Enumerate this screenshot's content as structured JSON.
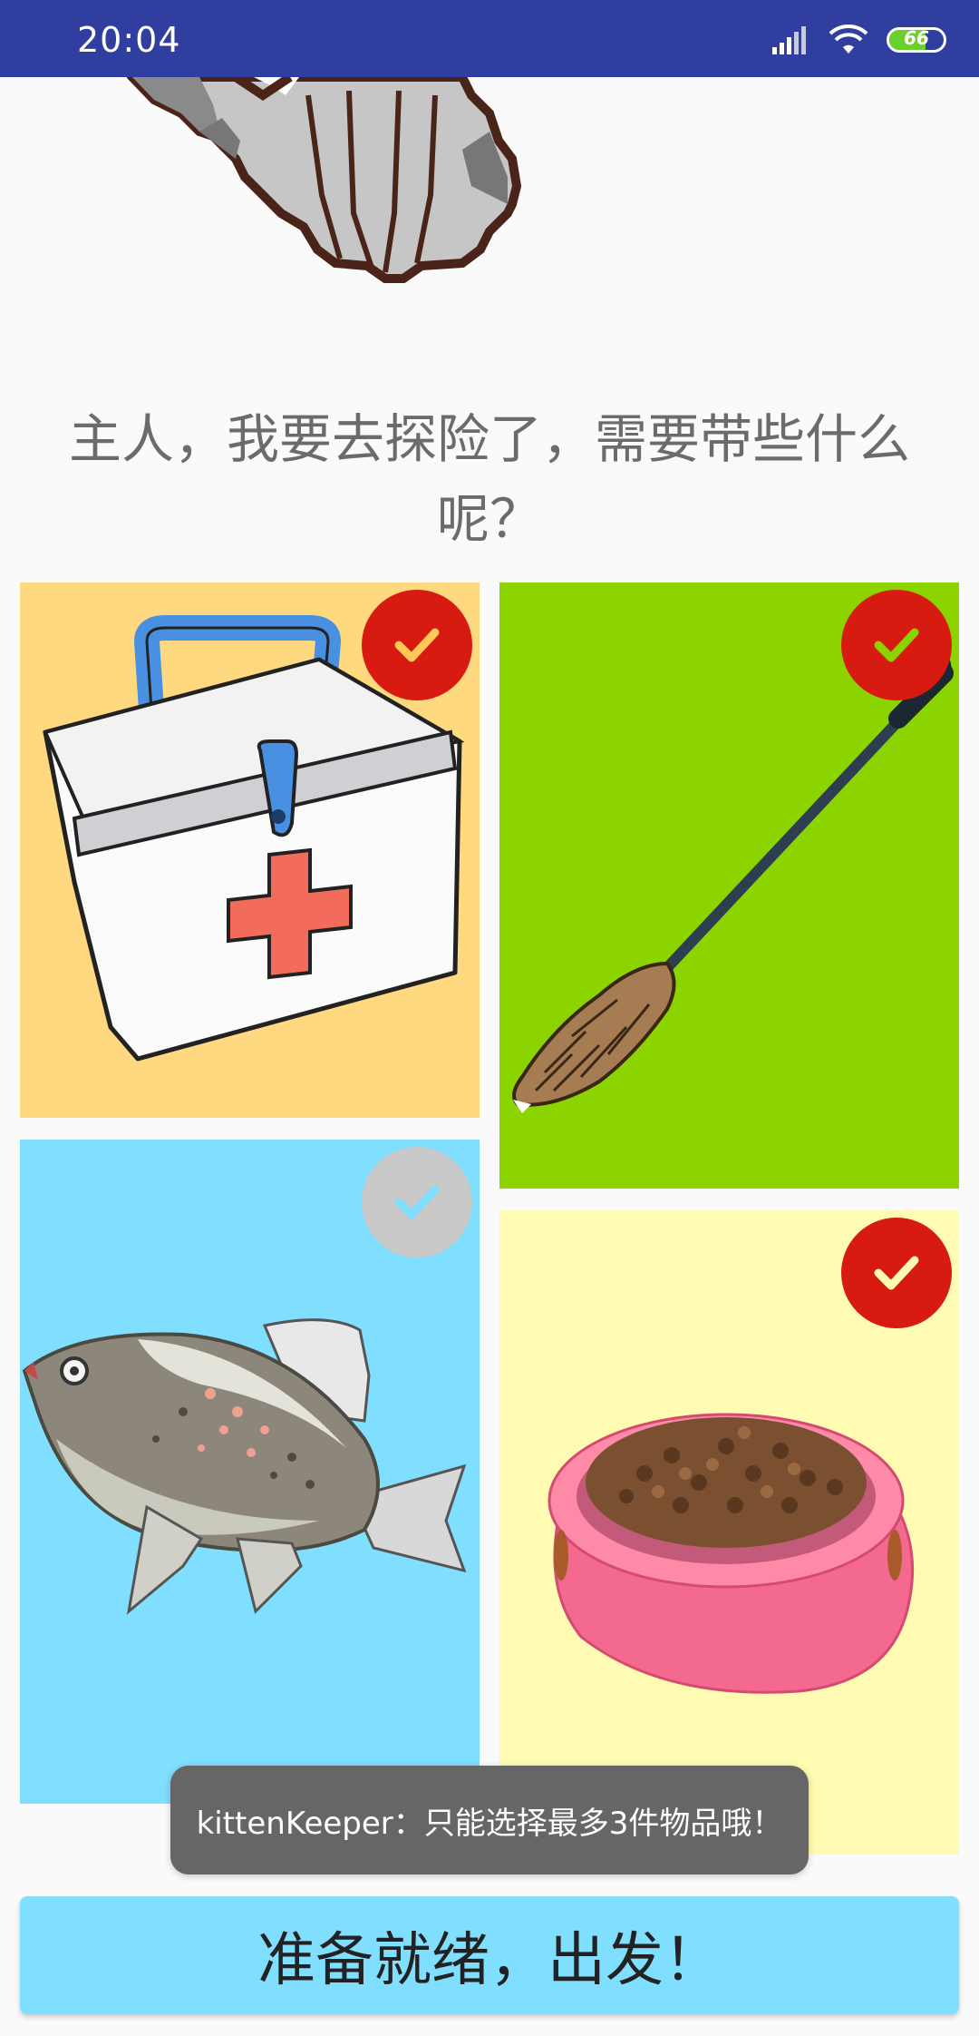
{
  "status_bar": {
    "time": "20:04",
    "battery_level": 66,
    "battery_text": "66",
    "icons": [
      "signal-icon",
      "wifi-icon",
      "battery-icon"
    ]
  },
  "prompt": "主人，我要去探险了，需要带些什么呢？",
  "items": [
    {
      "name": "first-aid-kit",
      "selected": true,
      "background": "#ffd980"
    },
    {
      "name": "feather-duster",
      "selected": true,
      "background": "#8cd400"
    },
    {
      "name": "fish",
      "selected": false,
      "background": "#80deff"
    },
    {
      "name": "cat-food-bowl",
      "selected": true,
      "background": "#fffbb2"
    }
  ],
  "toast": "kittenKeeper：只能选择最多3件物品哦！",
  "go_button": "准备就绪，出发！",
  "colors": {
    "status_bar": "#303f9f",
    "check_selected": "#d81b10",
    "check_unselected": "#c9c9c9",
    "button": "#80deff"
  }
}
